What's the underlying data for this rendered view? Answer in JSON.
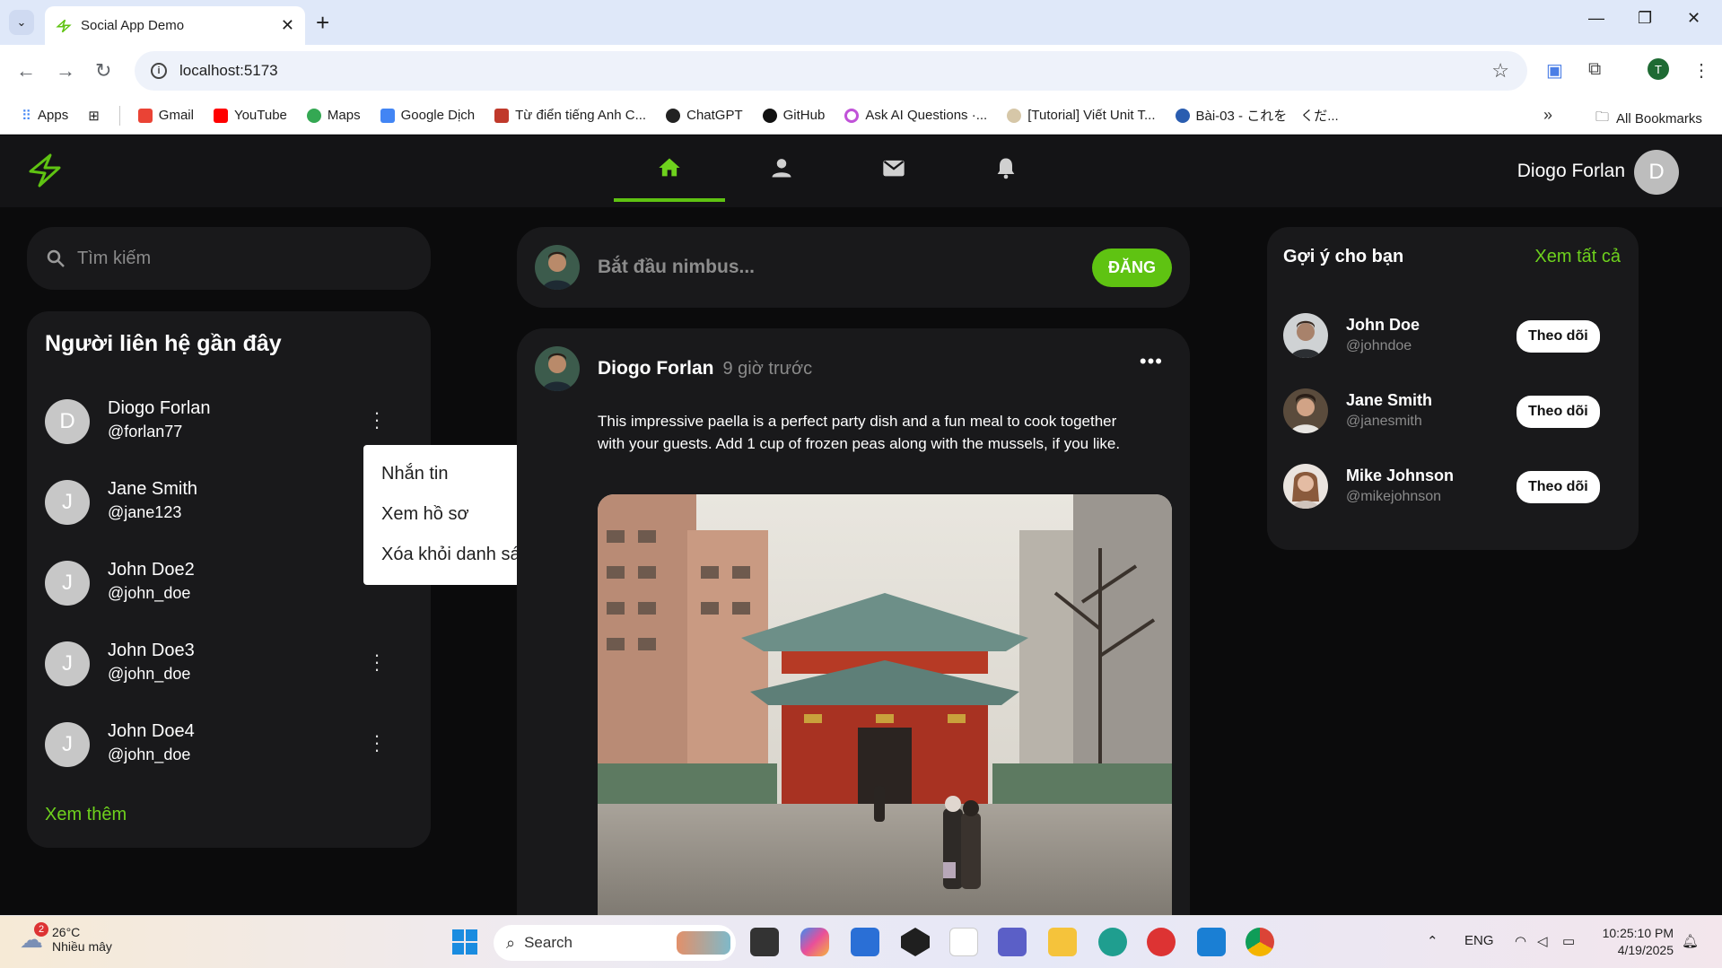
{
  "browser": {
    "tab_title": "Social App Demo",
    "url": "localhost:5173",
    "profile_letter": "T",
    "bookmarks": [
      "Apps",
      "Gmail",
      "YouTube",
      "Maps",
      "Google Dịch",
      "Từ điển tiếng Anh C...",
      "ChatGPT",
      "GitHub",
      "Ask AI Questions ·...",
      "[Tutorial] Viết Unit T...",
      "Bài-03 - これを　くだ..."
    ],
    "all_bookmarks": "All Bookmarks",
    "colors": {
      "tabstrip": "#dfe8f9"
    }
  },
  "app": {
    "accent_color": "#5fc312",
    "user": {
      "name": "Diogo Forlan",
      "initial": "D"
    },
    "nav_icons": [
      "home-icon",
      "person-icon",
      "mail-icon",
      "bell-icon"
    ],
    "search": {
      "placeholder": "Tìm kiếm"
    },
    "contacts": {
      "title": "Người liên hệ gần đây",
      "items": [
        {
          "initial": "D",
          "name": "Diogo Forlan",
          "handle": "@forlan77"
        },
        {
          "initial": "J",
          "name": "Jane Smith",
          "handle": "@jane123"
        },
        {
          "initial": "J",
          "name": "John Doe2",
          "handle": "@john_doe"
        },
        {
          "initial": "J",
          "name": "John Doe3",
          "handle": "@john_doe"
        },
        {
          "initial": "J",
          "name": "John Doe4",
          "handle": "@john_doe"
        }
      ],
      "see_more": "Xem thêm"
    },
    "context_menu": {
      "items": [
        "Nhắn tin",
        "Xem hồ sơ",
        "Xóa khỏi danh sách"
      ]
    },
    "composer": {
      "placeholder": "Bắt đầu nimbus...",
      "post_button": "ĐĂNG"
    },
    "post": {
      "author": "Diogo Forlan",
      "time": "9 giờ trước",
      "text": "This impressive paella is a perfect party dish and a fun meal to cook together with your guests. Add 1 cup of frozen peas along with the mussels, if you like."
    },
    "suggestions": {
      "title": "Gợi ý cho bạn",
      "see_all": "Xem tất cả",
      "follow_label": "Theo dõi",
      "items": [
        {
          "name": "John Doe",
          "handle": "@johndoe"
        },
        {
          "name": "Jane Smith",
          "handle": "@janesmith"
        },
        {
          "name": "Mike Johnson",
          "handle": "@mikejohnson"
        }
      ]
    }
  },
  "taskbar": {
    "weather": {
      "temp": "26°C",
      "condition": "Nhiều mây",
      "badge": "2"
    },
    "search_label": "Search",
    "language": "ENG",
    "time": "10:25:10 PM",
    "date": "4/19/2025"
  }
}
